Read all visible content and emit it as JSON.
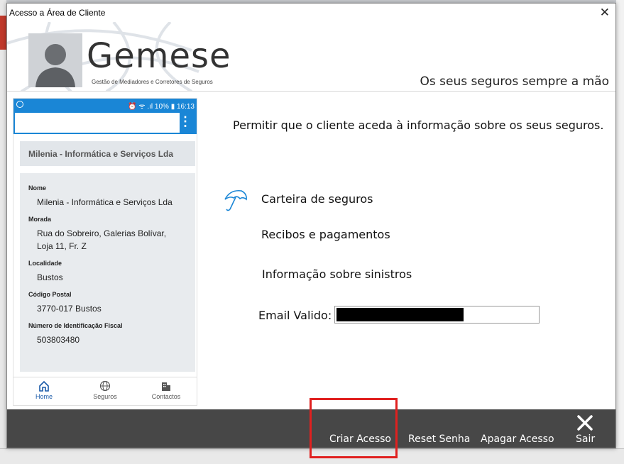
{
  "window": {
    "title": "Acesso a Área de Cliente"
  },
  "header": {
    "brand": "Gemese",
    "brand_subtitle": "Gestão de Mediadores e Corretores de Seguros",
    "tagline": "Os seus seguros sempre a mão"
  },
  "phone": {
    "status": {
      "right": "⏰ ᯤ .ıl 10% ▮ 16:13"
    },
    "company_name": "Milenia - Informática e Serviços Lda",
    "fields": [
      {
        "label": "Nome",
        "value": "Milenia - Informática e Serviços Lda"
      },
      {
        "label": "Morada",
        "value_lines": [
          "Rua do Sobreiro, Galerias Bolívar,",
          "Loja 11, Fr. Z"
        ]
      },
      {
        "label": "Localidade",
        "value": "Bustos"
      },
      {
        "label": "Código Postal",
        "value": "3770-017 Bustos"
      },
      {
        "label": "Número de Identificação Fiscal",
        "value": "503803480"
      }
    ],
    "tabs": [
      {
        "label": "Home",
        "icon": "home-icon",
        "active": true
      },
      {
        "label": "Seguros",
        "icon": "globe-icon"
      },
      {
        "label": "Contactos",
        "icon": "building-icon"
      }
    ],
    "accent": "#1a86d6"
  },
  "main": {
    "permission_text": "Permitir que o cliente aceda à informação sobre os seus seguros.",
    "features": [
      "Carteira de seguros",
      "Recibos e pagamentos",
      "Informação sobre sinistros"
    ],
    "email_label": "Email Valido:"
  },
  "footer": {
    "buttons": [
      "Criar Acesso",
      "Reset Senha",
      "Apagar Acesso",
      "Sair"
    ],
    "highlight_color": "#e0201f"
  }
}
